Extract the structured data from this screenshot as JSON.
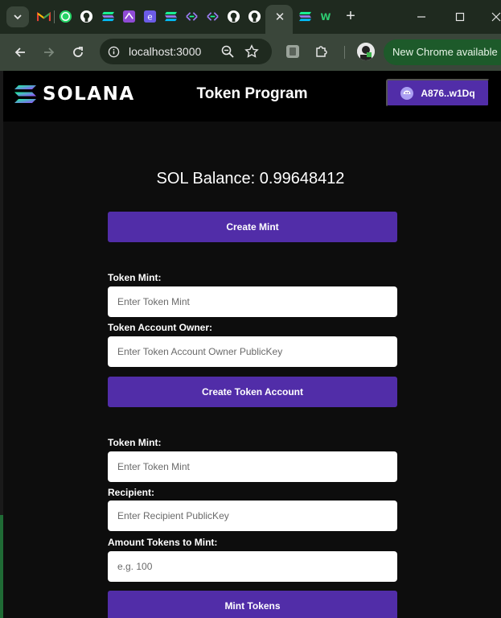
{
  "browser": {
    "url": "localhost:3000",
    "new_chrome_text": "New Chrome available",
    "tab_icons": [
      "gmail-icon",
      "whatsapp-icon",
      "github-icon",
      "solana-icon",
      "phantom-icon",
      "ethereum-icon",
      "solana-icon",
      "solana-explorer-icon",
      "solana-explorer-icon",
      "github-icon",
      "github-icon",
      "solana-icon",
      "webflow-icon"
    ]
  },
  "header": {
    "logo_text": "SOLANA",
    "title": "Token Program",
    "wallet_label": "A876..w1Dq"
  },
  "balance": {
    "text": "SOL Balance: 0.99648412"
  },
  "create_mint": {
    "button_label": "Create Mint"
  },
  "create_token_account": {
    "mint_label": "Token Mint:",
    "mint_placeholder": "Enter Token Mint",
    "owner_label": "Token Account Owner:",
    "owner_placeholder": "Enter Token Account Owner PublicKey",
    "button_label": "Create Token Account"
  },
  "mint_tokens": {
    "mint_label": "Token Mint:",
    "mint_placeholder": "Enter Token Mint",
    "recipient_label": "Recipient:",
    "recipient_placeholder": "Enter Recipient PublicKey",
    "amount_label": "Amount Tokens to Mint:",
    "amount_placeholder": "e.g. 100",
    "button_label": "Mint Tokens"
  },
  "colors": {
    "accent": "#512da8",
    "page_bg": "#0d0d0d",
    "header_bg": "#000000",
    "chrome_bg": "#1f2a1f",
    "toolbar_bg": "#3a463a"
  }
}
